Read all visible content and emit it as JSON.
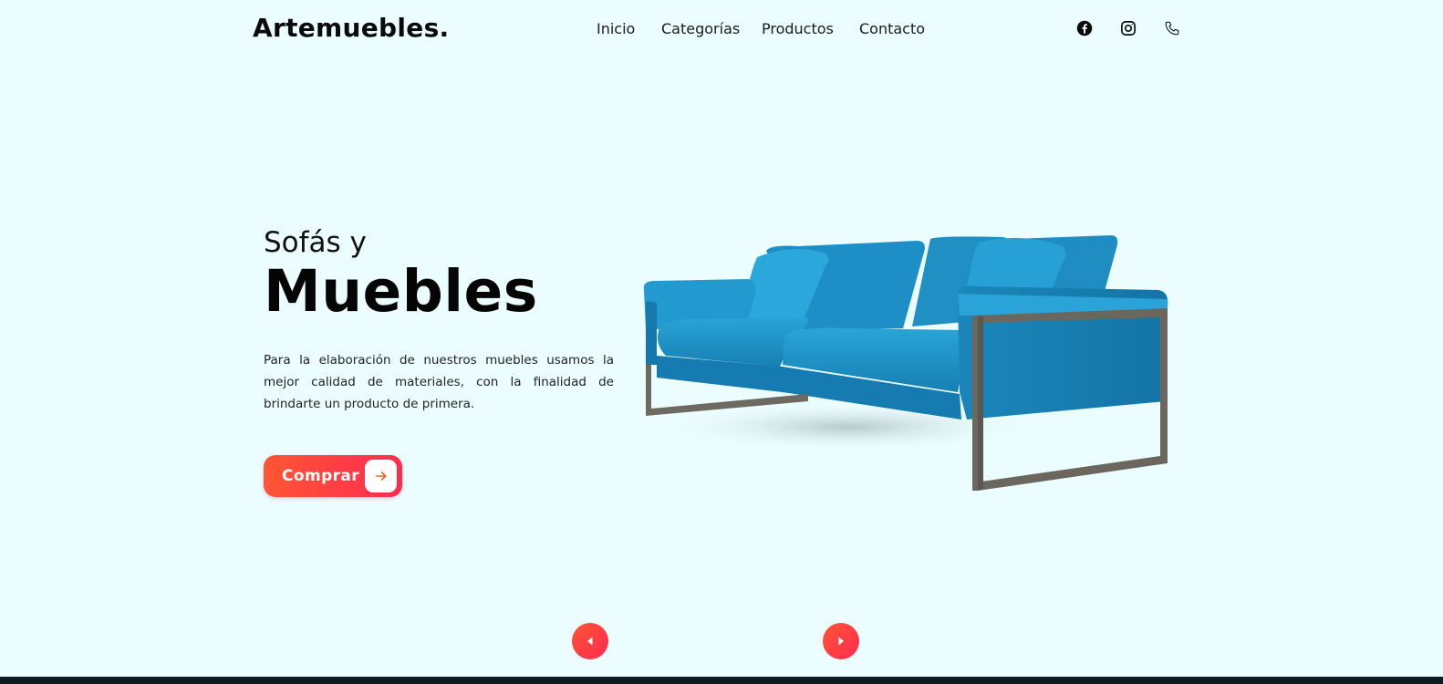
{
  "header": {
    "logo": "Artemuebles.",
    "nav": [
      "Inicio",
      "Categorías",
      "Productos",
      "Contacto"
    ],
    "social_icons": [
      "facebook-icon",
      "instagram-icon",
      "phone-icon"
    ]
  },
  "hero": {
    "subtitle": "Sofás y",
    "title": "Muebles",
    "description": "Para la elaboración de nuestros muebles usamos la mejor calidad de materiales, con la finalidad de brindarte un producto de primera.",
    "cta_label": "Comprar",
    "cta_icon": "arrow-right-icon",
    "image": "blue-sofa-image"
  },
  "slider": {
    "prev_icon": "caret-left-icon",
    "next_icon": "caret-right-icon"
  },
  "colors": {
    "background": "#ebfdfe",
    "accent_start": "#ff5535",
    "accent_end": "#ff2b50",
    "sofa_blue": "#1e90c4"
  }
}
